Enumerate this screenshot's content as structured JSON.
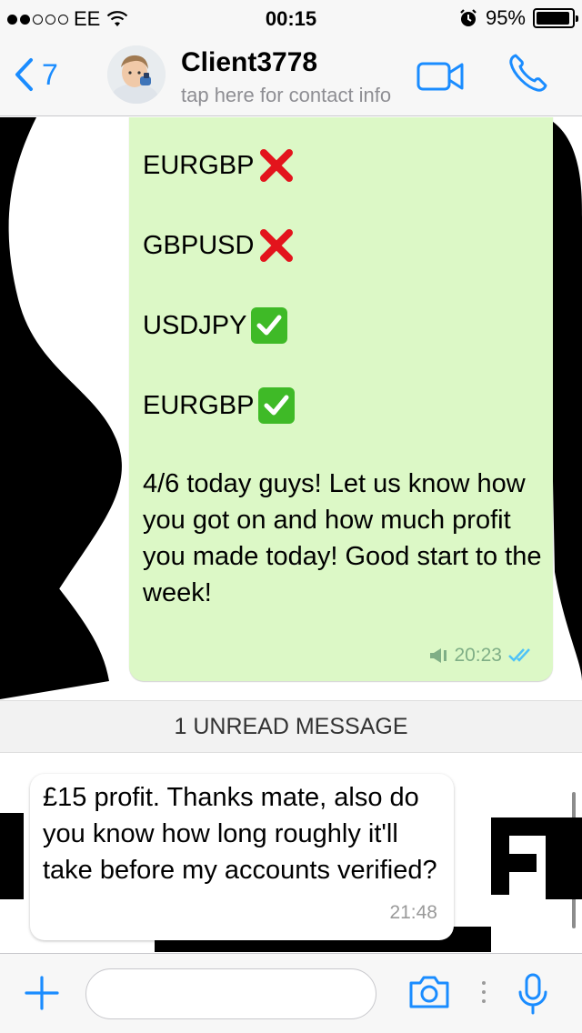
{
  "status_bar": {
    "signal_dots_filled": 2,
    "signal_dots_total": 5,
    "carrier": "EE",
    "time": "00:15",
    "battery": "95%",
    "battery_level": 0.95
  },
  "header": {
    "back_count": "7",
    "contact_name": "Client3778",
    "contact_subtitle": "tap here for contact info"
  },
  "messages": {
    "outgoing": {
      "lines": [
        {
          "pair": "EURGBP",
          "result": "loss",
          "icon": "red-cross-icon"
        },
        {
          "pair": "GBPUSD",
          "result": "loss",
          "icon": "red-cross-icon"
        },
        {
          "pair": "USDJPY",
          "result": "win",
          "icon": "green-check-icon"
        },
        {
          "pair": "EURGBP",
          "result": "win",
          "icon": "green-check-icon"
        }
      ],
      "final_text": "4/6 today guys! Let us know how you got on and how much profit you made today! Good start to the week!",
      "time": "20:23",
      "status": "read"
    },
    "unread_separator": "1 UNREAD MESSAGE",
    "incoming": {
      "text": "£15 profit. Thanks mate, also do you know how long roughly it'll take before my accounts verified?",
      "time": "21:48"
    }
  },
  "input_bar": {
    "placeholder": "",
    "value": ""
  },
  "colors": {
    "accent": "#1a8cff",
    "outgoing_bubble": "#dcf8c6",
    "incoming_bubble": "#ffffff",
    "read_ticks": "#4fc3f7",
    "cross": "#e3141c",
    "check": "#3fba27"
  }
}
